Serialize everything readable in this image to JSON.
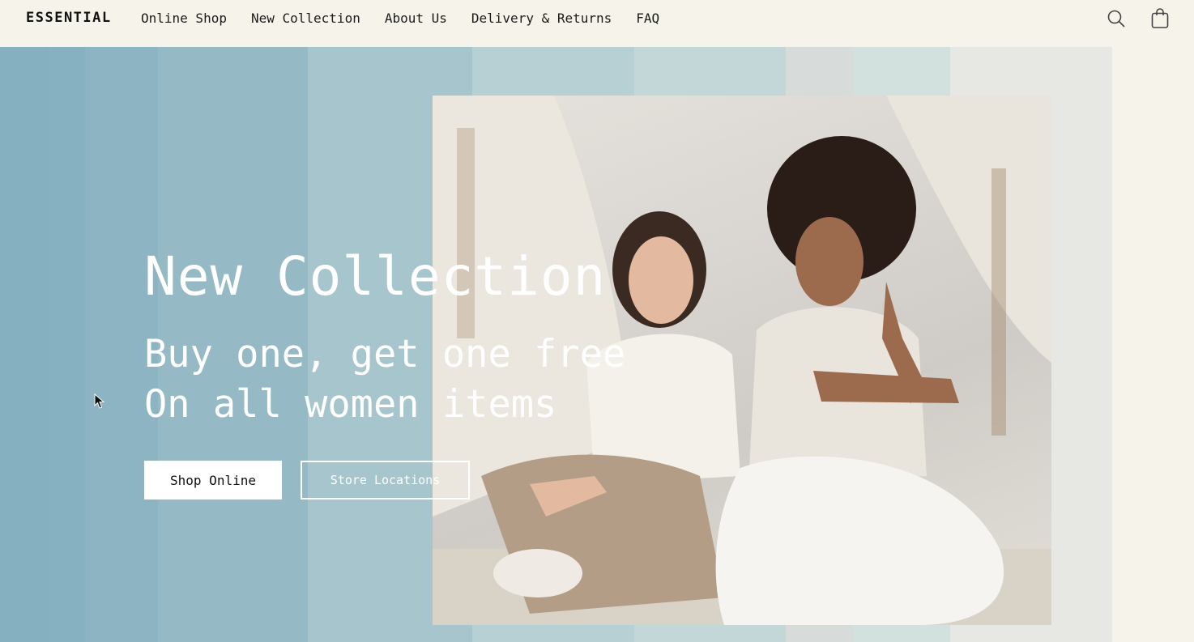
{
  "brand": "ESSENTIAL",
  "nav": {
    "items": [
      {
        "label": "Online Shop"
      },
      {
        "label": "New Collection"
      },
      {
        "label": "About Us"
      },
      {
        "label": "Delivery & Returns"
      },
      {
        "label": "FAQ"
      }
    ]
  },
  "header_icons": [
    "search-icon",
    "shopping-bag-icon"
  ],
  "hero": {
    "title": "New Collection",
    "subtitle_line1": "Buy one, get one free",
    "subtitle_line2": "On all women items",
    "primary_button": "Shop Online",
    "secondary_button": "Store Locations"
  },
  "colors": {
    "page_background": "#f5f3ea",
    "hero_left": "#86b1c0",
    "hero_mid": "#a7c6cd",
    "hero_right": "#e7e8e4",
    "text_light": "#ffffff",
    "text_dark": "#111111"
  }
}
